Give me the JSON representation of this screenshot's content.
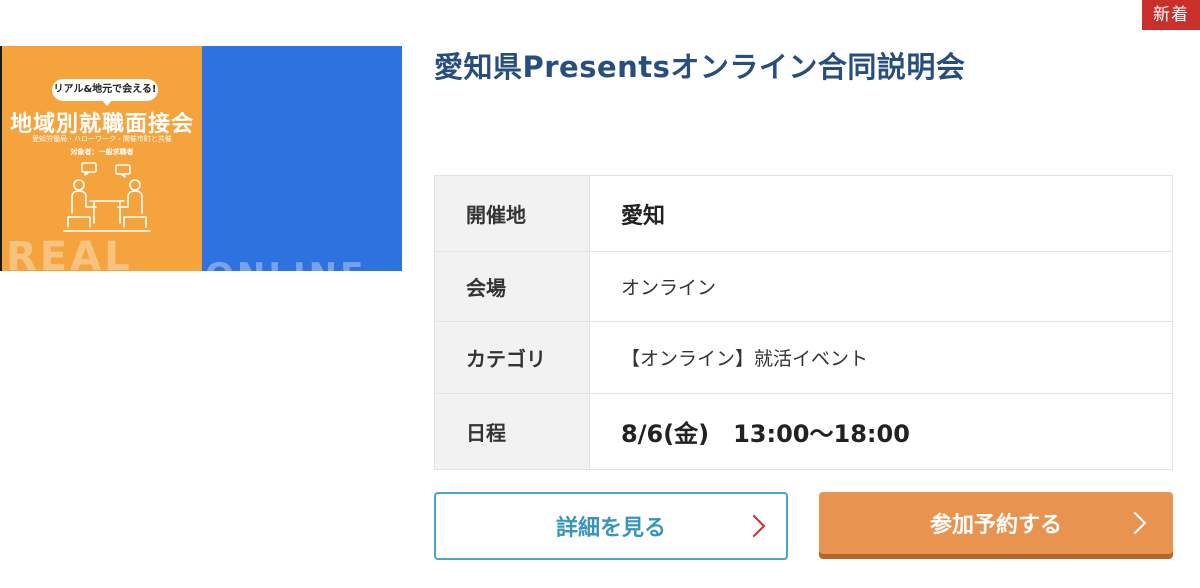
{
  "badge": {
    "label": "新着"
  },
  "banner": {
    "pill_text": "リアル&地元で会える!",
    "title": "地域別就職面接会",
    "subtitle": "愛知労働局・ハローワーク・開催市町と共催",
    "target": "対象者：一般求職者",
    "bg_left": "REAL",
    "bg_right": "ONLINE"
  },
  "event": {
    "title": "愛知県Presentsオンライン合同説明会"
  },
  "info": {
    "rows": [
      {
        "label": "開催地",
        "value": "愛知"
      },
      {
        "label": "会場",
        "value": "オンライン"
      },
      {
        "label": "カテゴリ",
        "value": "【オンライン】就活イベント"
      },
      {
        "label": "日程",
        "value": "8/6(金)　13:00〜18:00"
      }
    ]
  },
  "buttons": {
    "detail_label": "詳細を見る",
    "reserve_label": "参加予約する"
  },
  "colors": {
    "accent_blue": "#274e7d",
    "detail_border": "#49a5c4",
    "reserve_bg": "#e89450",
    "badge_bg": "#c9302c"
  }
}
